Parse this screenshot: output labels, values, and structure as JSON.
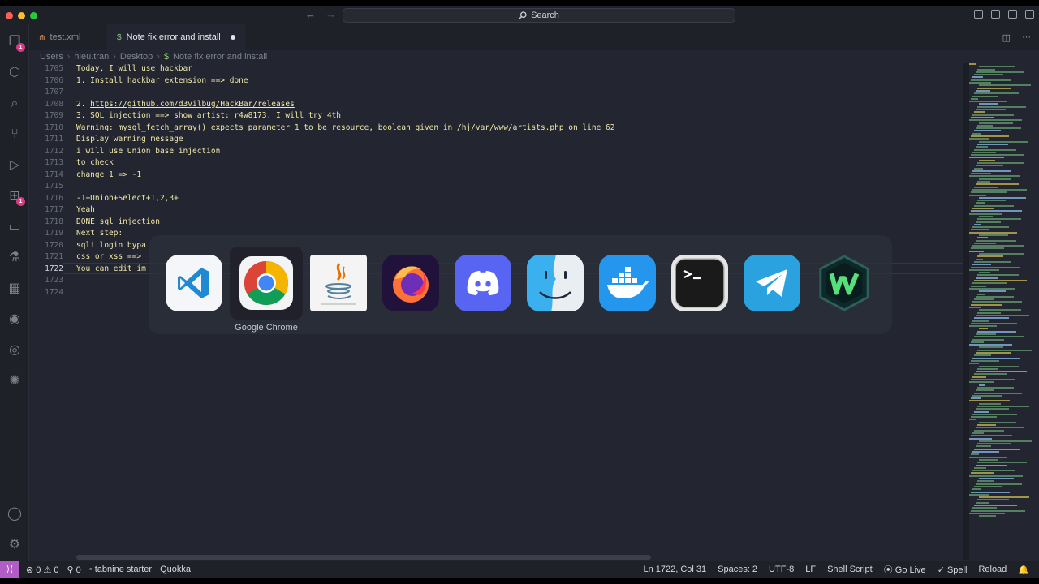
{
  "titlebar": {
    "search_label": "Search"
  },
  "tabs": [
    {
      "label": "test.xml",
      "icon": "rss-like-xml-icon"
    },
    {
      "label": "Note fix error and install",
      "icon": "dollar-shell-icon",
      "dirty": true
    }
  ],
  "breadcrumb": [
    "Users",
    "hieu.tran",
    "Desktop",
    "Note fix error and install"
  ],
  "editor": {
    "current_line": "1722",
    "lines": [
      {
        "num": "1705",
        "text": "Today, I will use hackbar"
      },
      {
        "num": "1706",
        "text": "1. Install hackbar extension ==> done"
      },
      {
        "num": "1707",
        "text": ""
      },
      {
        "num": "1708",
        "text": "2. ",
        "link": "https://github.com/d3vilbug/HackBar/releases"
      },
      {
        "num": "1709",
        "text": "3. SQL injection ==> show artist: r4w8173. I will try 4th"
      },
      {
        "num": "1710",
        "text": "Warning: mysql_fetch_array() expects parameter 1 to be resource, boolean given in /hj/var/www/artists.php on line 62"
      },
      {
        "num": "1711",
        "text": "Display warning message"
      },
      {
        "num": "1712",
        "text": "i will use Union base injection"
      },
      {
        "num": "1713",
        "text": "to check"
      },
      {
        "num": "1714",
        "text": "change 1 => -1"
      },
      {
        "num": "1715",
        "text": ""
      },
      {
        "num": "1716",
        "text": "-1+Union+Select+1,2,3+"
      },
      {
        "num": "1717",
        "text": "Yeah"
      },
      {
        "num": "1718",
        "text": "DONE sql injection"
      },
      {
        "num": "1719",
        "text": "Next step:"
      },
      {
        "num": "1720",
        "text": "sqli login bypa"
      },
      {
        "num": "1721",
        "text": "css or xss ==>"
      },
      {
        "num": "1722",
        "text": "You can edit im"
      },
      {
        "num": "1723",
        "text": ""
      },
      {
        "num": "1724",
        "text": ""
      }
    ]
  },
  "app_switcher": {
    "selected_label": "Google Chrome",
    "apps": [
      "vscode",
      "google-chrome",
      "java",
      "firefox",
      "discord",
      "finder",
      "docker",
      "terminal",
      "telegram",
      "windscribe"
    ]
  },
  "statusbar": {
    "errors": "0",
    "warnings": "0",
    "ports": "0",
    "tabnine": "tabnine starter",
    "quokka": "Quokka",
    "position": "Ln 1722, Col 31",
    "spaces": "Spaces: 2",
    "encoding": "UTF-8",
    "eol": "LF",
    "language": "Shell Script",
    "golive": "Go Live",
    "spell": "Spell",
    "reload": "Reload"
  },
  "colors": {
    "editor_bg": "#232530",
    "text_yellow": "#f0e9a8",
    "accent_purple": "#b15cc7",
    "badge_pink": "#d73a83"
  }
}
